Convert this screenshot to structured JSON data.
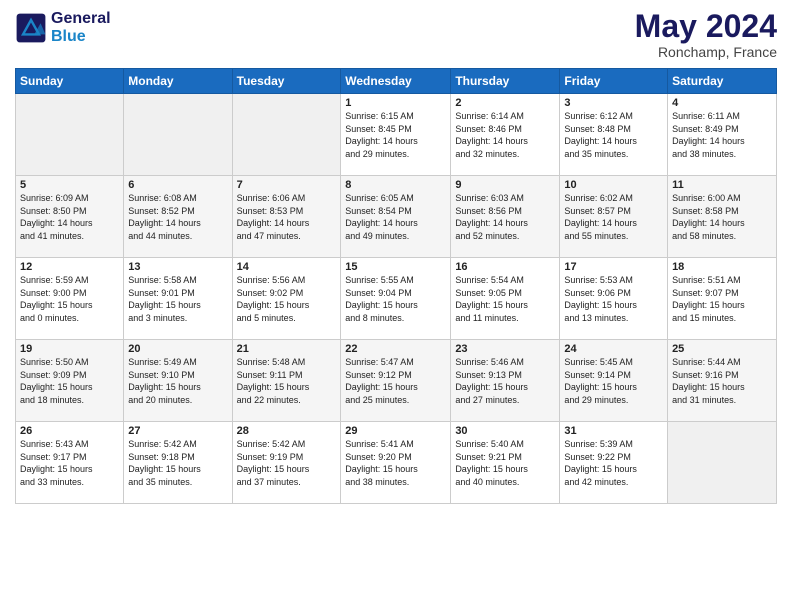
{
  "header": {
    "logo_line1": "General",
    "logo_line2": "Blue",
    "month": "May 2024",
    "location": "Ronchamp, France"
  },
  "weekdays": [
    "Sunday",
    "Monday",
    "Tuesday",
    "Wednesday",
    "Thursday",
    "Friday",
    "Saturday"
  ],
  "weeks": [
    [
      {
        "day": "",
        "info": ""
      },
      {
        "day": "",
        "info": ""
      },
      {
        "day": "",
        "info": ""
      },
      {
        "day": "1",
        "info": "Sunrise: 6:15 AM\nSunset: 8:45 PM\nDaylight: 14 hours\nand 29 minutes."
      },
      {
        "day": "2",
        "info": "Sunrise: 6:14 AM\nSunset: 8:46 PM\nDaylight: 14 hours\nand 32 minutes."
      },
      {
        "day": "3",
        "info": "Sunrise: 6:12 AM\nSunset: 8:48 PM\nDaylight: 14 hours\nand 35 minutes."
      },
      {
        "day": "4",
        "info": "Sunrise: 6:11 AM\nSunset: 8:49 PM\nDaylight: 14 hours\nand 38 minutes."
      }
    ],
    [
      {
        "day": "5",
        "info": "Sunrise: 6:09 AM\nSunset: 8:50 PM\nDaylight: 14 hours\nand 41 minutes."
      },
      {
        "day": "6",
        "info": "Sunrise: 6:08 AM\nSunset: 8:52 PM\nDaylight: 14 hours\nand 44 minutes."
      },
      {
        "day": "7",
        "info": "Sunrise: 6:06 AM\nSunset: 8:53 PM\nDaylight: 14 hours\nand 47 minutes."
      },
      {
        "day": "8",
        "info": "Sunrise: 6:05 AM\nSunset: 8:54 PM\nDaylight: 14 hours\nand 49 minutes."
      },
      {
        "day": "9",
        "info": "Sunrise: 6:03 AM\nSunset: 8:56 PM\nDaylight: 14 hours\nand 52 minutes."
      },
      {
        "day": "10",
        "info": "Sunrise: 6:02 AM\nSunset: 8:57 PM\nDaylight: 14 hours\nand 55 minutes."
      },
      {
        "day": "11",
        "info": "Sunrise: 6:00 AM\nSunset: 8:58 PM\nDaylight: 14 hours\nand 58 minutes."
      }
    ],
    [
      {
        "day": "12",
        "info": "Sunrise: 5:59 AM\nSunset: 9:00 PM\nDaylight: 15 hours\nand 0 minutes."
      },
      {
        "day": "13",
        "info": "Sunrise: 5:58 AM\nSunset: 9:01 PM\nDaylight: 15 hours\nand 3 minutes."
      },
      {
        "day": "14",
        "info": "Sunrise: 5:56 AM\nSunset: 9:02 PM\nDaylight: 15 hours\nand 5 minutes."
      },
      {
        "day": "15",
        "info": "Sunrise: 5:55 AM\nSunset: 9:04 PM\nDaylight: 15 hours\nand 8 minutes."
      },
      {
        "day": "16",
        "info": "Sunrise: 5:54 AM\nSunset: 9:05 PM\nDaylight: 15 hours\nand 11 minutes."
      },
      {
        "day": "17",
        "info": "Sunrise: 5:53 AM\nSunset: 9:06 PM\nDaylight: 15 hours\nand 13 minutes."
      },
      {
        "day": "18",
        "info": "Sunrise: 5:51 AM\nSunset: 9:07 PM\nDaylight: 15 hours\nand 15 minutes."
      }
    ],
    [
      {
        "day": "19",
        "info": "Sunrise: 5:50 AM\nSunset: 9:09 PM\nDaylight: 15 hours\nand 18 minutes."
      },
      {
        "day": "20",
        "info": "Sunrise: 5:49 AM\nSunset: 9:10 PM\nDaylight: 15 hours\nand 20 minutes."
      },
      {
        "day": "21",
        "info": "Sunrise: 5:48 AM\nSunset: 9:11 PM\nDaylight: 15 hours\nand 22 minutes."
      },
      {
        "day": "22",
        "info": "Sunrise: 5:47 AM\nSunset: 9:12 PM\nDaylight: 15 hours\nand 25 minutes."
      },
      {
        "day": "23",
        "info": "Sunrise: 5:46 AM\nSunset: 9:13 PM\nDaylight: 15 hours\nand 27 minutes."
      },
      {
        "day": "24",
        "info": "Sunrise: 5:45 AM\nSunset: 9:14 PM\nDaylight: 15 hours\nand 29 minutes."
      },
      {
        "day": "25",
        "info": "Sunrise: 5:44 AM\nSunset: 9:16 PM\nDaylight: 15 hours\nand 31 minutes."
      }
    ],
    [
      {
        "day": "26",
        "info": "Sunrise: 5:43 AM\nSunset: 9:17 PM\nDaylight: 15 hours\nand 33 minutes."
      },
      {
        "day": "27",
        "info": "Sunrise: 5:42 AM\nSunset: 9:18 PM\nDaylight: 15 hours\nand 35 minutes."
      },
      {
        "day": "28",
        "info": "Sunrise: 5:42 AM\nSunset: 9:19 PM\nDaylight: 15 hours\nand 37 minutes."
      },
      {
        "day": "29",
        "info": "Sunrise: 5:41 AM\nSunset: 9:20 PM\nDaylight: 15 hours\nand 38 minutes."
      },
      {
        "day": "30",
        "info": "Sunrise: 5:40 AM\nSunset: 9:21 PM\nDaylight: 15 hours\nand 40 minutes."
      },
      {
        "day": "31",
        "info": "Sunrise: 5:39 AM\nSunset: 9:22 PM\nDaylight: 15 hours\nand 42 minutes."
      },
      {
        "day": "",
        "info": ""
      }
    ]
  ]
}
